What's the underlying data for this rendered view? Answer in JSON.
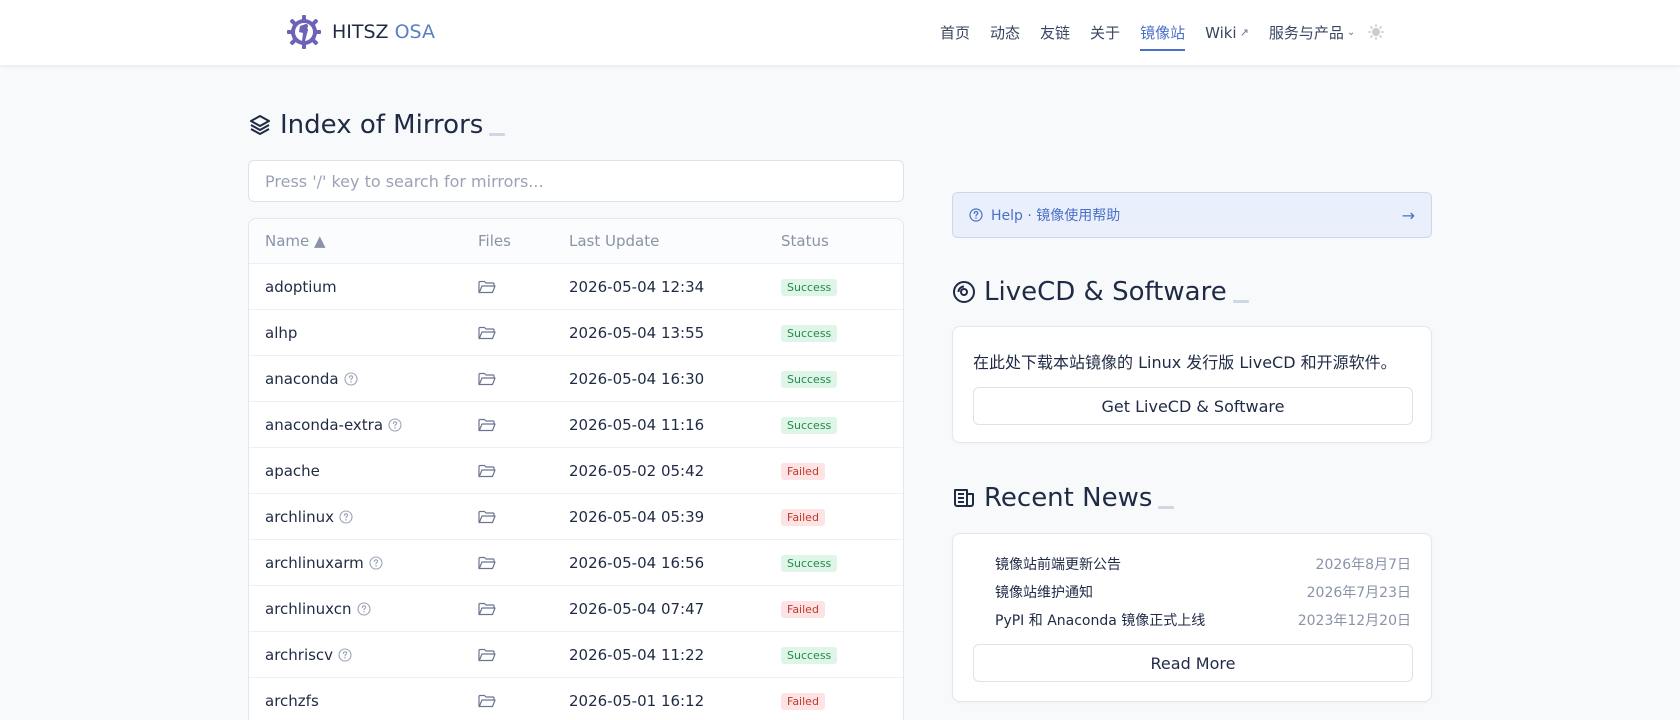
{
  "header": {
    "brand_name": "HITSZ",
    "brand_suffix": "OSA",
    "nav": [
      {
        "label": "首页"
      },
      {
        "label": "动态"
      },
      {
        "label": "友链"
      },
      {
        "label": "关于"
      },
      {
        "label": "镜像站"
      },
      {
        "label": "Wiki"
      },
      {
        "label": "服务与产品"
      }
    ],
    "active_nav": "镜像站",
    "ext_glyph": "↗",
    "chevron_glyph": "⌄"
  },
  "mirrors": {
    "title": "Index of Mirrors",
    "search_placeholder": "Press '/' key to search for mirrors...",
    "columns": {
      "name": "Name ▲",
      "files": "Files",
      "last_update": "Last Update",
      "status": "Status"
    },
    "rows": [
      {
        "name": "adoptium",
        "help": false,
        "last_update": "2026-05-04 12:34",
        "status": "Success"
      },
      {
        "name": "alhp",
        "help": false,
        "last_update": "2026-05-04 13:55",
        "status": "Success"
      },
      {
        "name": "anaconda",
        "help": true,
        "last_update": "2026-05-04 16:30",
        "status": "Success"
      },
      {
        "name": "anaconda-extra",
        "help": true,
        "last_update": "2026-05-04 11:16",
        "status": "Success"
      },
      {
        "name": "apache",
        "help": false,
        "last_update": "2026-05-02 05:42",
        "status": "Failed"
      },
      {
        "name": "archlinux",
        "help": true,
        "last_update": "2026-05-04 05:39",
        "status": "Failed"
      },
      {
        "name": "archlinuxarm",
        "help": true,
        "last_update": "2026-05-04 16:56",
        "status": "Success"
      },
      {
        "name": "archlinuxcn",
        "help": true,
        "last_update": "2026-05-04 07:47",
        "status": "Failed"
      },
      {
        "name": "archriscv",
        "help": true,
        "last_update": "2026-05-04 11:22",
        "status": "Success"
      },
      {
        "name": "archzfs",
        "help": false,
        "last_update": "2026-05-01 16:12",
        "status": "Failed"
      }
    ]
  },
  "help_bar": {
    "label": "Help · 镜像使用帮助",
    "arrow": "→"
  },
  "livecd": {
    "title": "LiveCD & Software",
    "description": "在此处下载本站镜像的 Linux 发行版 LiveCD 和开源软件。",
    "button_label": "Get LiveCD & Software"
  },
  "news": {
    "title": "Recent News",
    "items": [
      {
        "title": "镜像站前端更新公告",
        "date": "2026年8月7日"
      },
      {
        "title": "镜像站维护通知",
        "date": "2026年7月23日"
      },
      {
        "title": "PyPI 和 Anaconda 镜像正式上线",
        "date": "2023年12月20日"
      }
    ],
    "read_more_label": "Read More"
  },
  "colors": {
    "accent": "#4a6fc8",
    "success_bg": "#dff5e7",
    "success_text": "#1f8a4c",
    "failed_bg": "#fde3e3",
    "failed_text": "#c0392b"
  }
}
